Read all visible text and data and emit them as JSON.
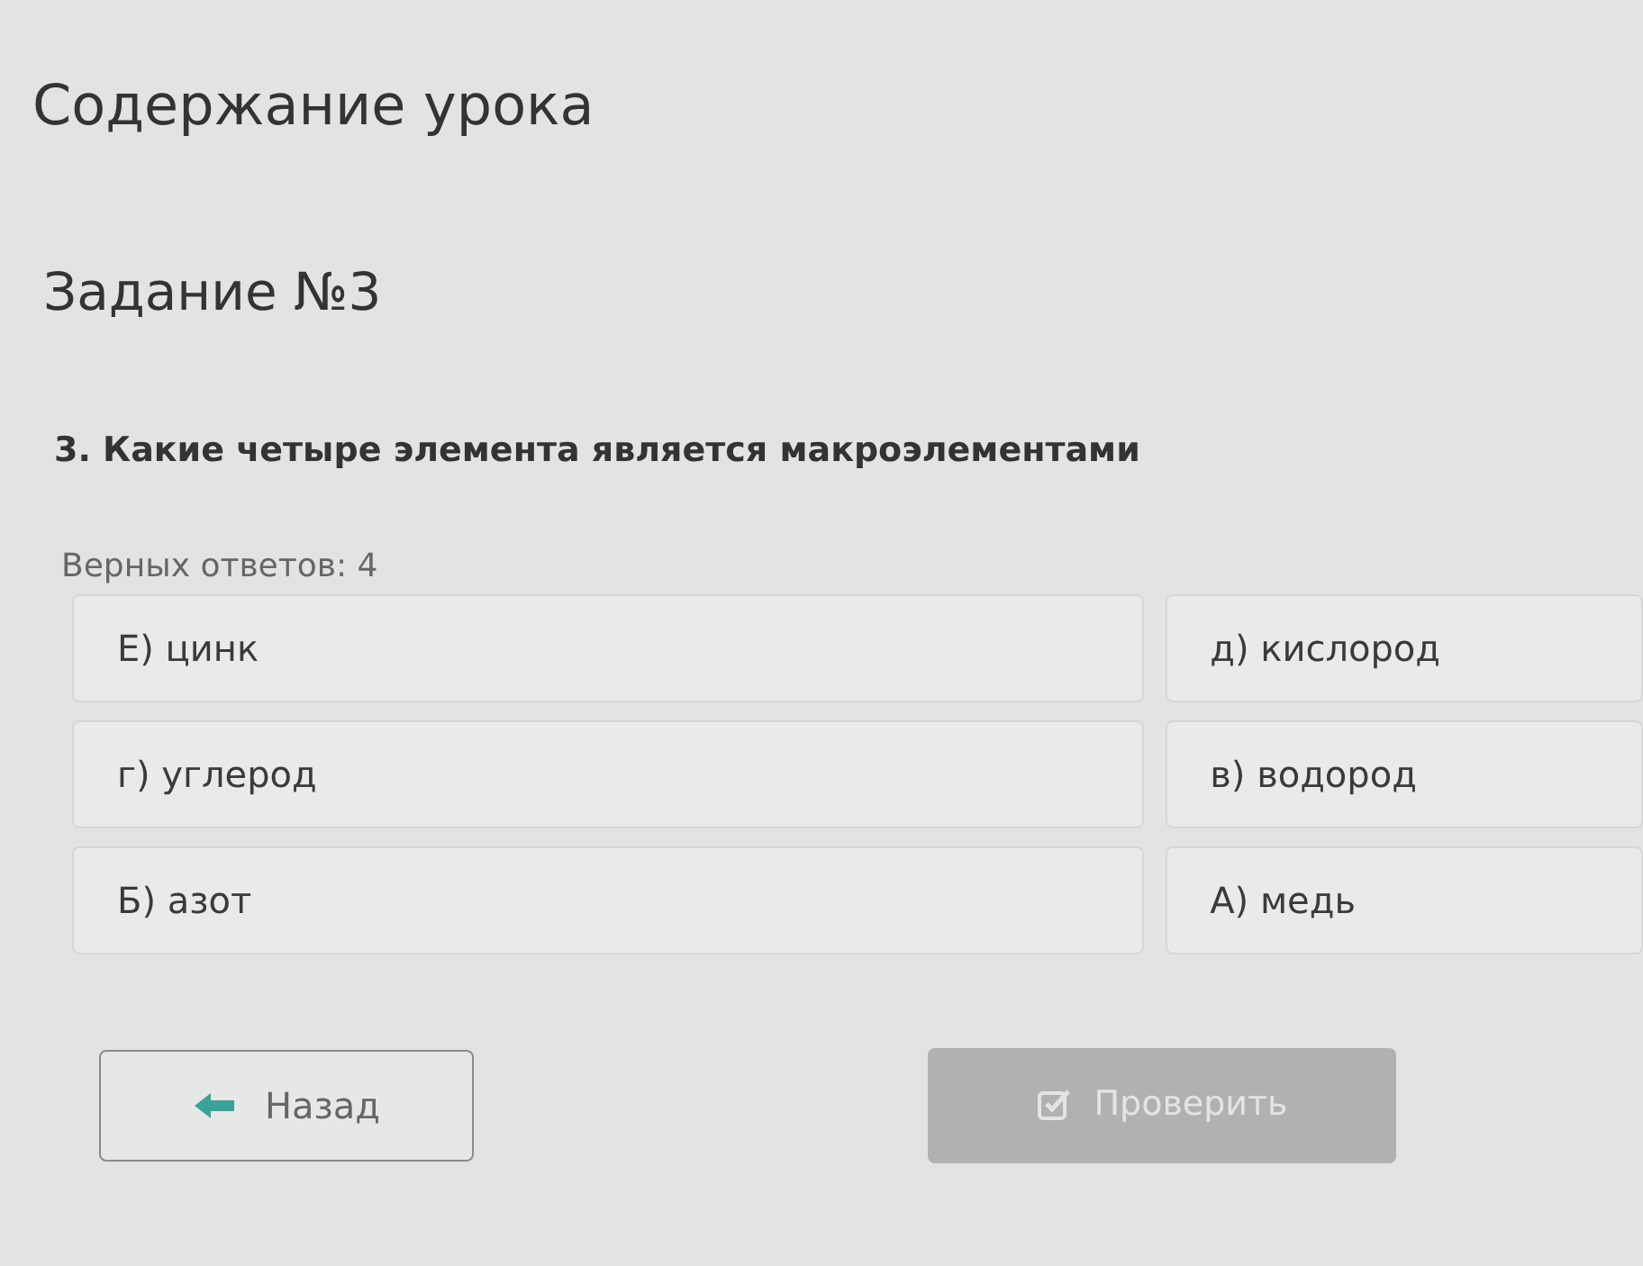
{
  "header": {
    "title": "Содержание урока"
  },
  "task": {
    "title": "Задание №3",
    "question": "3. Какие четыре элемента является макроэлементами",
    "answers_count": "Верных ответов: 4"
  },
  "options_left": [
    {
      "label": "Е) цинк"
    },
    {
      "label": "г) углерод"
    },
    {
      "label": "Б) азот"
    }
  ],
  "options_right": [
    {
      "label": "д) кислород"
    },
    {
      "label": "в) водород"
    },
    {
      "label": "А) медь"
    }
  ],
  "back_button": {
    "label": "Назад"
  },
  "check_button": {
    "label": "Проверить",
    "disabled": true
  }
}
